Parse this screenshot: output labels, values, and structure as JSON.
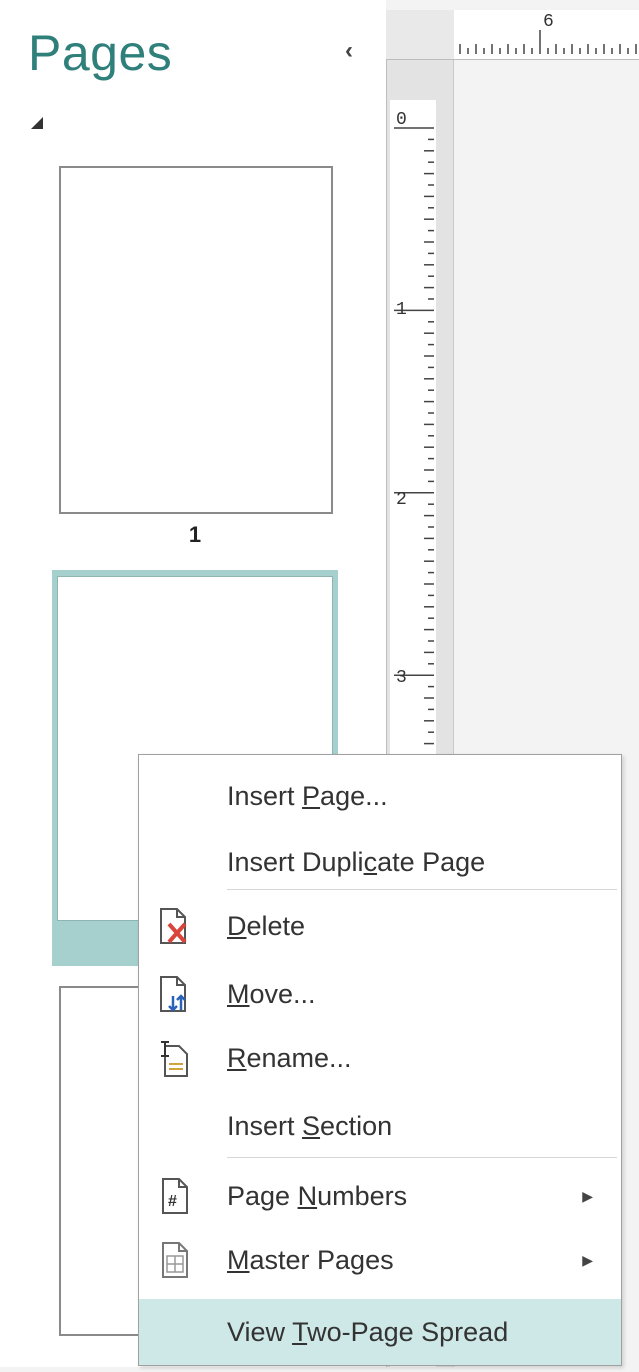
{
  "pane": {
    "title": "Pages",
    "collapse_glyph": "‹",
    "thumbnails": [
      {
        "label": "1"
      }
    ]
  },
  "rulers": {
    "horizontal_marks": [
      "6"
    ],
    "vertical_marks": [
      "0",
      "1",
      "2",
      "3"
    ]
  },
  "context_menu": {
    "items": [
      {
        "label": "Insert Page...",
        "mnemonic": "P",
        "icon": "none"
      },
      {
        "label": "Insert Duplicate Page",
        "mnemonic": "c",
        "icon": "none"
      },
      {
        "label": "Delete",
        "mnemonic": "D",
        "icon": "delete-page-icon"
      },
      {
        "label": "Move...",
        "mnemonic": "M",
        "icon": "move-page-icon"
      },
      {
        "label": "Rename...",
        "mnemonic": "R",
        "icon": "rename-page-icon"
      },
      {
        "label": "Insert Section",
        "mnemonic": "S",
        "icon": "none"
      },
      {
        "label": "Page Numbers",
        "mnemonic": "N",
        "icon": "page-numbers-icon",
        "submenu": true
      },
      {
        "label": "Master Pages",
        "mnemonic": "M",
        "icon": "master-pages-icon",
        "submenu": true
      },
      {
        "label": "View Two-Page Spread",
        "mnemonic": "T",
        "icon": "none",
        "highlighted": true
      }
    ]
  },
  "colors": {
    "accent": "#2f7f7a",
    "selection": "#a6d0cd",
    "menu_highlight": "#cde8e6",
    "delete_red": "#d9443b"
  }
}
